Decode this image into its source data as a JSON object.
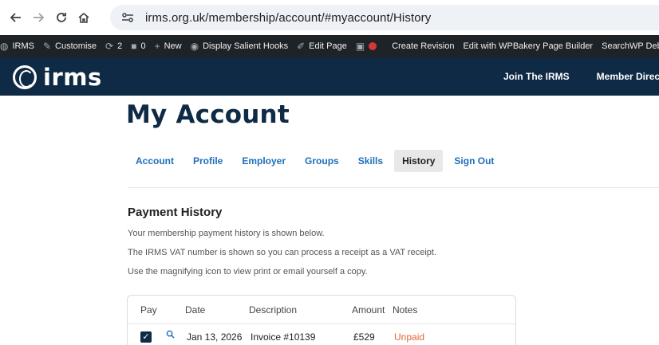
{
  "browser": {
    "url": "irms.org.uk/membership/account/#myaccount/History"
  },
  "admin_bar": {
    "items": [
      {
        "icon": "wordpress-icon",
        "label": "IRMS"
      },
      {
        "icon": "brush-icon",
        "label": "Customise"
      },
      {
        "icon": "updates-icon",
        "label": "2"
      },
      {
        "icon": "comment-icon",
        "label": "0"
      },
      {
        "icon": "plus-icon",
        "label": "New"
      },
      {
        "icon": "eye-icon",
        "label": "Display Salient Hooks"
      },
      {
        "icon": "pencil-icon",
        "label": "Edit Page"
      },
      {
        "icon": "yoast-icon",
        "label": ""
      },
      {
        "icon": "red-dot-icon",
        "label": ""
      },
      {
        "icon": "",
        "label": "Create Revision"
      },
      {
        "icon": "",
        "label": "Edit with WPBakery Page Builder"
      },
      {
        "icon": "",
        "label": "SearchWP Debug"
      }
    ]
  },
  "header": {
    "logo_text": "irms",
    "nav": [
      "Join The IRMS",
      "Member Directo"
    ]
  },
  "page": {
    "title": "My Account",
    "tabs": [
      "Account",
      "Profile",
      "Employer",
      "Groups",
      "Skills",
      "History",
      "Sign Out"
    ],
    "active_tab": "History"
  },
  "payment_history": {
    "title": "Payment History",
    "lines": [
      "Your membership payment history is shown below.",
      "The IRMS VAT number is shown so you can process a receipt as a VAT receipt.",
      "Use the magnifying icon to view print or email yourself a copy."
    ],
    "columns": [
      "Pay",
      "Date",
      "Description",
      "Amount",
      "Notes"
    ],
    "rows": [
      {
        "date": "Jan 13, 2026",
        "description": "Invoice #10139",
        "amount": "£529",
        "notes": "Unpaid"
      }
    ]
  },
  "colors": {
    "brand_navy": "#0f2a44",
    "link_blue": "#1e6fb9",
    "unpaid_orange": "#e0633a"
  }
}
